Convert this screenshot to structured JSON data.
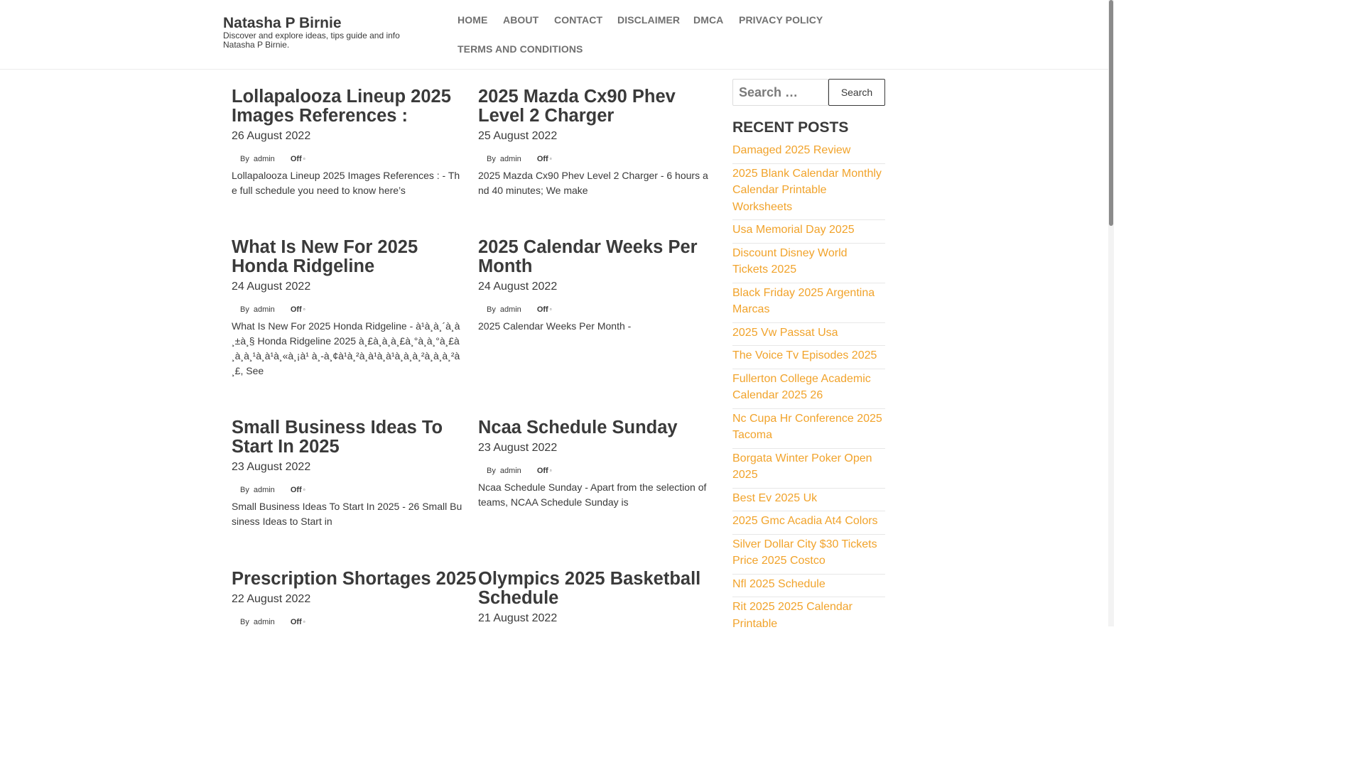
{
  "header": {
    "site_title": "Natasha P Birnie",
    "tagline": "Discover and explore ideas, tips guide and info Natasha P Birnie.",
    "nav": [
      "HOME",
      "ABOUT",
      "CONTACT",
      "DISCLAIMER",
      "DMCA",
      "PRIVACY POLICY",
      "TERMS AND CONDITIONS"
    ]
  },
  "posts": [
    {
      "title": "Lollapalooza Lineup 2025 Images References :",
      "date": "26 August 2022",
      "by": "By",
      "author": "admin",
      "comments": "Off",
      "excerpt": "Lollapalooza Lineup 2025 Images References : - The full schedule you need to know here’s"
    },
    {
      "title": "2025 Mazda Cx90 Phev Level 2 Charger",
      "date": "25 August 2022",
      "by": "By",
      "author": "admin",
      "comments": "Off",
      "excerpt": "2025 Mazda Cx90 Phev Level 2 Charger - 6 hours and 40 minutes; We make"
    },
    {
      "title": "What Is New For 2025 Honda Ridgeline",
      "date": "24 August 2022",
      "by": "By",
      "author": "admin",
      "comments": "Off",
      "excerpt": "What Is New For 2025 Honda Ridgeline - à¹à¸à¸´à¸à¸±à¸§ Honda Ridgeline 2025 à¸£à¸à¸à¸£à¸°à¸à¸°à¸£à¸à¸à¸¹à¸à¹à¸«à¸¡à¹ à¸-à¸¢à¹à¸²à¸à¹à¸à¹à¸à¸à¸²à¸à¸à¸²à¸£, See"
    },
    {
      "title": "2025 Calendar Weeks Per Month",
      "date": "24 August 2022",
      "by": "By",
      "author": "admin",
      "comments": "Off",
      "excerpt": "2025 Calendar Weeks Per Month -"
    },
    {
      "title": "Small Business Ideas To Start In 2025",
      "date": "23 August 2022",
      "by": "By",
      "author": "admin",
      "comments": "Off",
      "excerpt": "Small Business Ideas To Start In 2025 - 26 Small Business Ideas to Start in"
    },
    {
      "title": "Ncaa Schedule Sunday",
      "date": "23 August 2022",
      "by": "By",
      "author": "admin",
      "comments": "Off",
      "excerpt": "Ncaa Schedule Sunday - Apart from the selection of teams, NCAA Schedule Sunday is"
    },
    {
      "title": "Prescription Shortages 2025",
      "date": "22 August 2022",
      "by": "By",
      "author": "admin",
      "comments": "Off",
      "excerpt": ""
    },
    {
      "title": "Olympics 2025 Basketball Schedule",
      "date": "21 August 2022",
      "by": "",
      "author": "",
      "comments": "",
      "excerpt": ""
    }
  ],
  "sidebar": {
    "search_placeholder": "Search …",
    "search_button": "Search",
    "recent_heading": "RECENT POSTS",
    "recent_posts": [
      "Damaged 2025 Review",
      "2025 Blank Calendar Monthly Calendar Printable Worksheets",
      "Usa Memorial Day 2025",
      "Discount Disney World Tickets 2025",
      "Black Friday 2025 Argentina Marcas",
      "2025 Vw Passat Usa",
      "The Voice Tv Episodes 2025",
      "Fullerton College Academic Calendar 2025 26",
      "Nc Cupa Hr Conference 2025 Tacoma",
      "Borgata Winter Poker Open 2025",
      "Best Ev 2025 Uk",
      "2025 Gmc Acadia At4 Colors",
      "Silver Dollar City $30 Tickets Price 2025 Costco",
      "Nfl 2025 Schedule",
      "Rit 2025 2025 Calendar Printable"
    ]
  },
  "colors": {
    "link_accent": "#f1a32b",
    "text": "#3a3a3a",
    "nav_text": "#707070"
  },
  "icons": {
    "comment_icon": "comment-icon"
  }
}
